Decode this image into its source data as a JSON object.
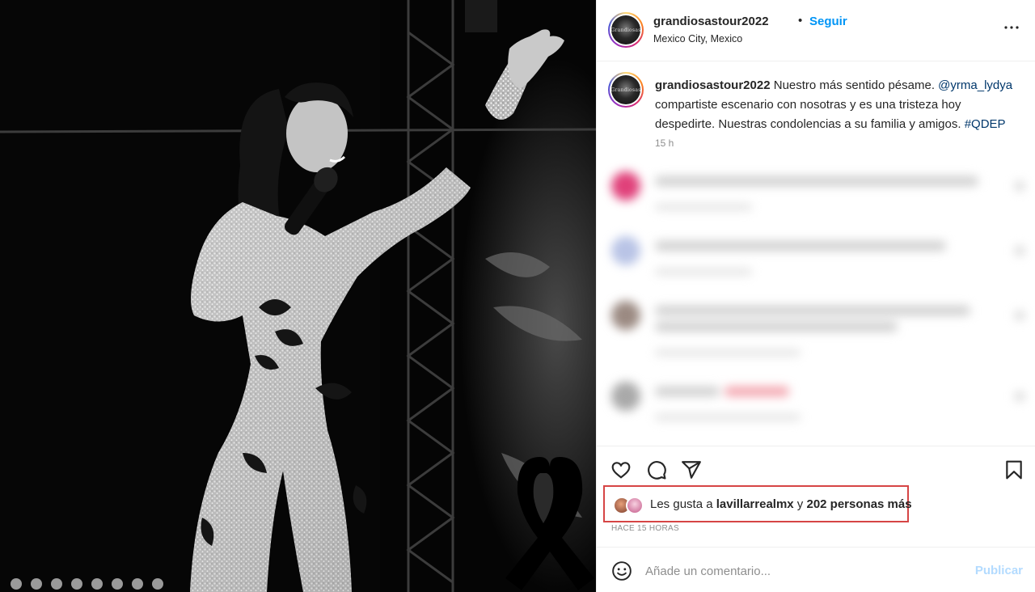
{
  "post": {
    "username": "grandiosastour2022",
    "separator": "•",
    "follow_label": "Seguir",
    "location": "Mexico City, Mexico",
    "avatar_text": "Grandiosas",
    "caption": {
      "username": "grandiosastour2022",
      "text_before": " Nuestro más sentido pésame. ",
      "mention": "@yrma_lydya",
      "text_after": " compartiste escenario con nosotras y es una tristeza hoy despedirte. Nuestras condolencias a su familia y amigos. ",
      "hashtag": "#QDEP",
      "time": "15 h"
    },
    "likes": {
      "prefix": "Les gusta a ",
      "user": "lavillarrealmx",
      "middle": " y ",
      "others": "202 personas más"
    },
    "post_time": "HACE 15 HORAS",
    "comment_placeholder": "Añade un comentario...",
    "publish_label": "Publicar"
  },
  "colors": {
    "link_blue": "#0095f6",
    "mention_blue": "#00376b",
    "highlight_red": "#d64545",
    "publish_disabled": "#b3dbff"
  },
  "icons": [
    "more-options-icon",
    "heart-icon",
    "comment-icon",
    "share-icon",
    "bookmark-icon",
    "emoji-icon",
    "mourning-ribbon-icon"
  ]
}
